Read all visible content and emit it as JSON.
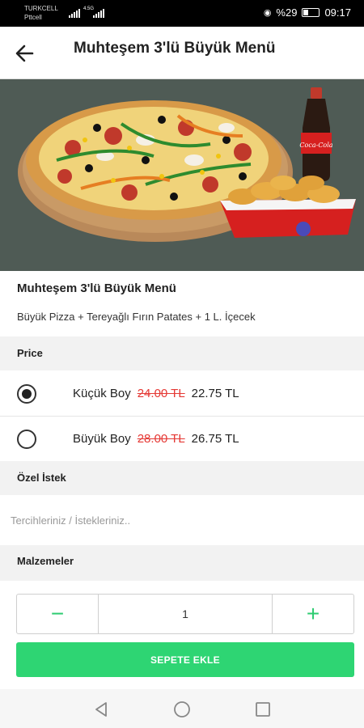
{
  "status": {
    "carrier1": "TURKCELL",
    "carrier2": "Pttcell",
    "net": "4.5G",
    "battery": "%29",
    "time": "09:17"
  },
  "header": {
    "title": "Muhteşem 3'lü Büyük Menü",
    "back_icon": "arrow-left-icon"
  },
  "product": {
    "title": "Muhteşem 3'lü Büyük Menü",
    "description": "Büyük Pizza + Tereyağlı Fırın Patates + 1 L. İçecek",
    "drink_brand": "Coca-Cola"
  },
  "price_section": {
    "label": "Price"
  },
  "options": [
    {
      "name": "Küçük Boy",
      "old_price": "24.00 TL",
      "price": "22.75 TL",
      "selected": true
    },
    {
      "name": "Büyük Boy",
      "old_price": "28.00 TL",
      "price": "26.75 TL",
      "selected": false
    }
  ],
  "notes_section": {
    "label": "Özel İstek",
    "placeholder": "Tercihleriniz / İstekleriniz..",
    "value": ""
  },
  "ingredients_section": {
    "label": "Malzemeler"
  },
  "quantity": {
    "minus": "−",
    "value": "1",
    "plus": "+"
  },
  "cart_button": {
    "label": "SEPETE EKLE"
  },
  "colors": {
    "accent": "#2ed573",
    "strike": "#e53935",
    "hero_bg": "#4f5b55"
  }
}
